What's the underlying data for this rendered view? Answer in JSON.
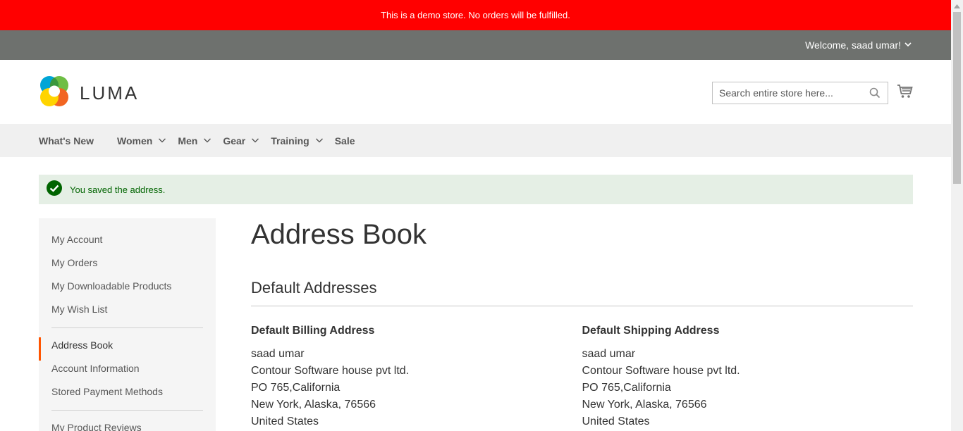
{
  "demo_notice": "This is a demo store. No orders will be fulfilled.",
  "header": {
    "welcome": "Welcome, saad umar!",
    "logo_text": "LUMA",
    "search_placeholder": "Search entire store here..."
  },
  "nav": [
    {
      "label": "What's New",
      "submenu": false
    },
    {
      "label": "Women",
      "submenu": true
    },
    {
      "label": "Men",
      "submenu": true
    },
    {
      "label": "Gear",
      "submenu": true
    },
    {
      "label": "Training",
      "submenu": true
    },
    {
      "label": "Sale",
      "submenu": false
    }
  ],
  "message": "You saved the address.",
  "sidebar": {
    "group1": [
      "My Account",
      "My Orders",
      "My Downloadable Products",
      "My Wish List"
    ],
    "group2": [
      "Address Book",
      "Account Information",
      "Stored Payment Methods"
    ],
    "group3": [
      "My Product Reviews"
    ],
    "current": "Address Book"
  },
  "main": {
    "title": "Address Book",
    "section_title": "Default Addresses",
    "billing": {
      "title": "Default Billing Address",
      "lines": [
        "saad umar",
        "Contour Software house pvt ltd.",
        "PO 765,California",
        "New York, Alaska, 76566",
        "United States"
      ]
    },
    "shipping": {
      "title": "Default Shipping Address",
      "lines": [
        "saad umar",
        "Contour Software house pvt ltd.",
        "PO 765,California",
        "New York, Alaska, 76566",
        "United States"
      ]
    }
  },
  "colors": {
    "demo_bar": "#ff0000",
    "panel_header": "#6e716e",
    "accent": "#ff5501",
    "success_bg": "#e5efe5",
    "success_text": "#006400"
  }
}
